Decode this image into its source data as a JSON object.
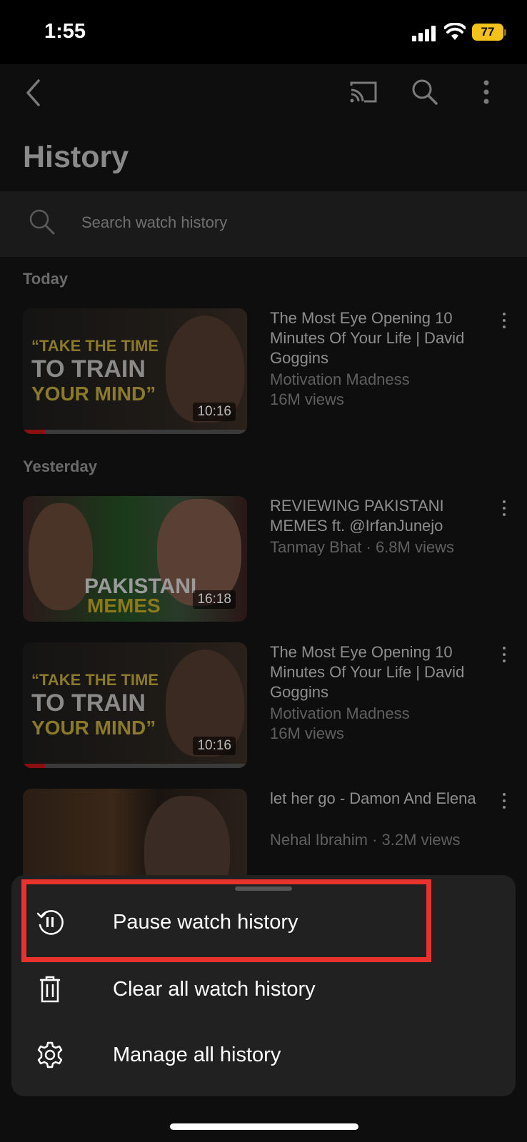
{
  "status_bar": {
    "time": "1:55",
    "battery": "77"
  },
  "header": {
    "title": "History"
  },
  "search": {
    "placeholder": "Search watch history"
  },
  "sections": {
    "today": "Today",
    "yesterday": "Yesterday"
  },
  "videos": [
    {
      "title": "The Most Eye Opening 10 Minutes Of Your Life | David Goggins",
      "channel": "Motivation Madness",
      "views": "16M views",
      "duration": "10:16",
      "progress": 0.1,
      "thumb_text": [
        "“TAKE THE TIME",
        "TO TRAIN",
        "YOUR MIND”"
      ]
    },
    {
      "title": "REVIEWING PAKISTANI MEMES  ft. @IrfanJunejo",
      "meta": "Tanmay Bhat · 6.8M views",
      "duration": "16:18",
      "thumb_text": [
        "PAKISTANI",
        "MEMES"
      ]
    },
    {
      "title": "The Most Eye Opening 10 Minutes Of Your Life | David Goggins",
      "channel": "Motivation Madness",
      "views": "16M views",
      "duration": "10:16",
      "progress": 0.1,
      "thumb_text": [
        "“TAKE THE TIME",
        "TO TRAIN",
        "YOUR MIND”"
      ]
    },
    {
      "title": "let her go - Damon And Elena",
      "meta": "Nehal Ibrahim · 3.2M views"
    }
  ],
  "sheet": {
    "items": [
      {
        "label": "Pause watch history",
        "icon": "pause-history-icon"
      },
      {
        "label": "Clear all watch history",
        "icon": "trash-icon"
      },
      {
        "label": "Manage all history",
        "icon": "gear-icon"
      }
    ]
  },
  "colors": {
    "highlight": "#e8322d",
    "battery": "#f2c21b",
    "progress": "#8a1010"
  }
}
